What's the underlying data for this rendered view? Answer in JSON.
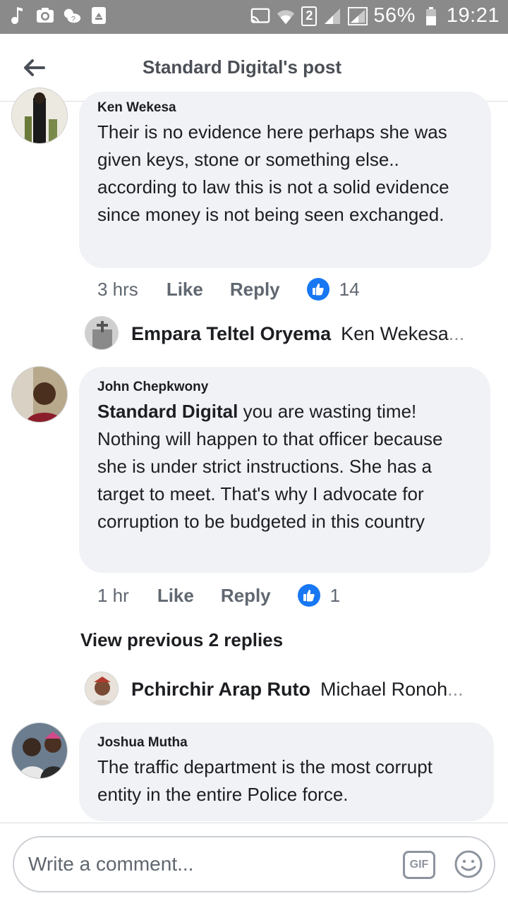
{
  "status_bar": {
    "icons_left": [
      "music-note-icon",
      "camera-icon",
      "weather-icon",
      "recycle-icon"
    ],
    "icons_right": [
      "cast-icon",
      "wifi-icon",
      "sim2-signal-icon",
      "signal-icon"
    ],
    "sim_badge": "2",
    "battery": "56%",
    "time": "19:21"
  },
  "header": {
    "title": "Standard Digital's post",
    "back_icon": "arrow-left-icon"
  },
  "comments": [
    {
      "author": "Ken Wekesa",
      "text": "Their is no evidence here perhaps she was given keys, stone or something else.. according to law this is not a solid evidence since money is not being seen exchanged.",
      "time": "3 hrs",
      "like_label": "Like",
      "reply_label": "Reply",
      "reactions": "14"
    },
    {
      "author": "John Chepkwony",
      "mention": "Standard Digital",
      "text": " you are wasting time! Nothing will happen to that officer because she is under strict instructions. She has a target to meet. That's why I advocate for corruption to be budgeted in this country",
      "time": "1 hr",
      "like_label": "Like",
      "reply_label": "Reply",
      "reactions": "1"
    },
    {
      "author": "Joshua Mutha",
      "text": "The traffic department is the most corrupt entity in the entire Police force."
    }
  ],
  "replies": [
    {
      "name": "Empara Teltel Oryema",
      "preview": "Ken Wekesa",
      "ellipsis": "..."
    },
    {
      "name": "Pchirchir Arap Ruto",
      "preview": "Michael Ronoh",
      "ellipsis": "..."
    }
  ],
  "view_previous": "View previous 2 replies",
  "composer": {
    "placeholder": "Write a comment...",
    "gif_label": "GIF"
  },
  "colors": {
    "status_bar": "#8a8a8a",
    "bubble": "#f0f2f5",
    "like_blue": "#1877f2",
    "muted_text": "#606770"
  }
}
